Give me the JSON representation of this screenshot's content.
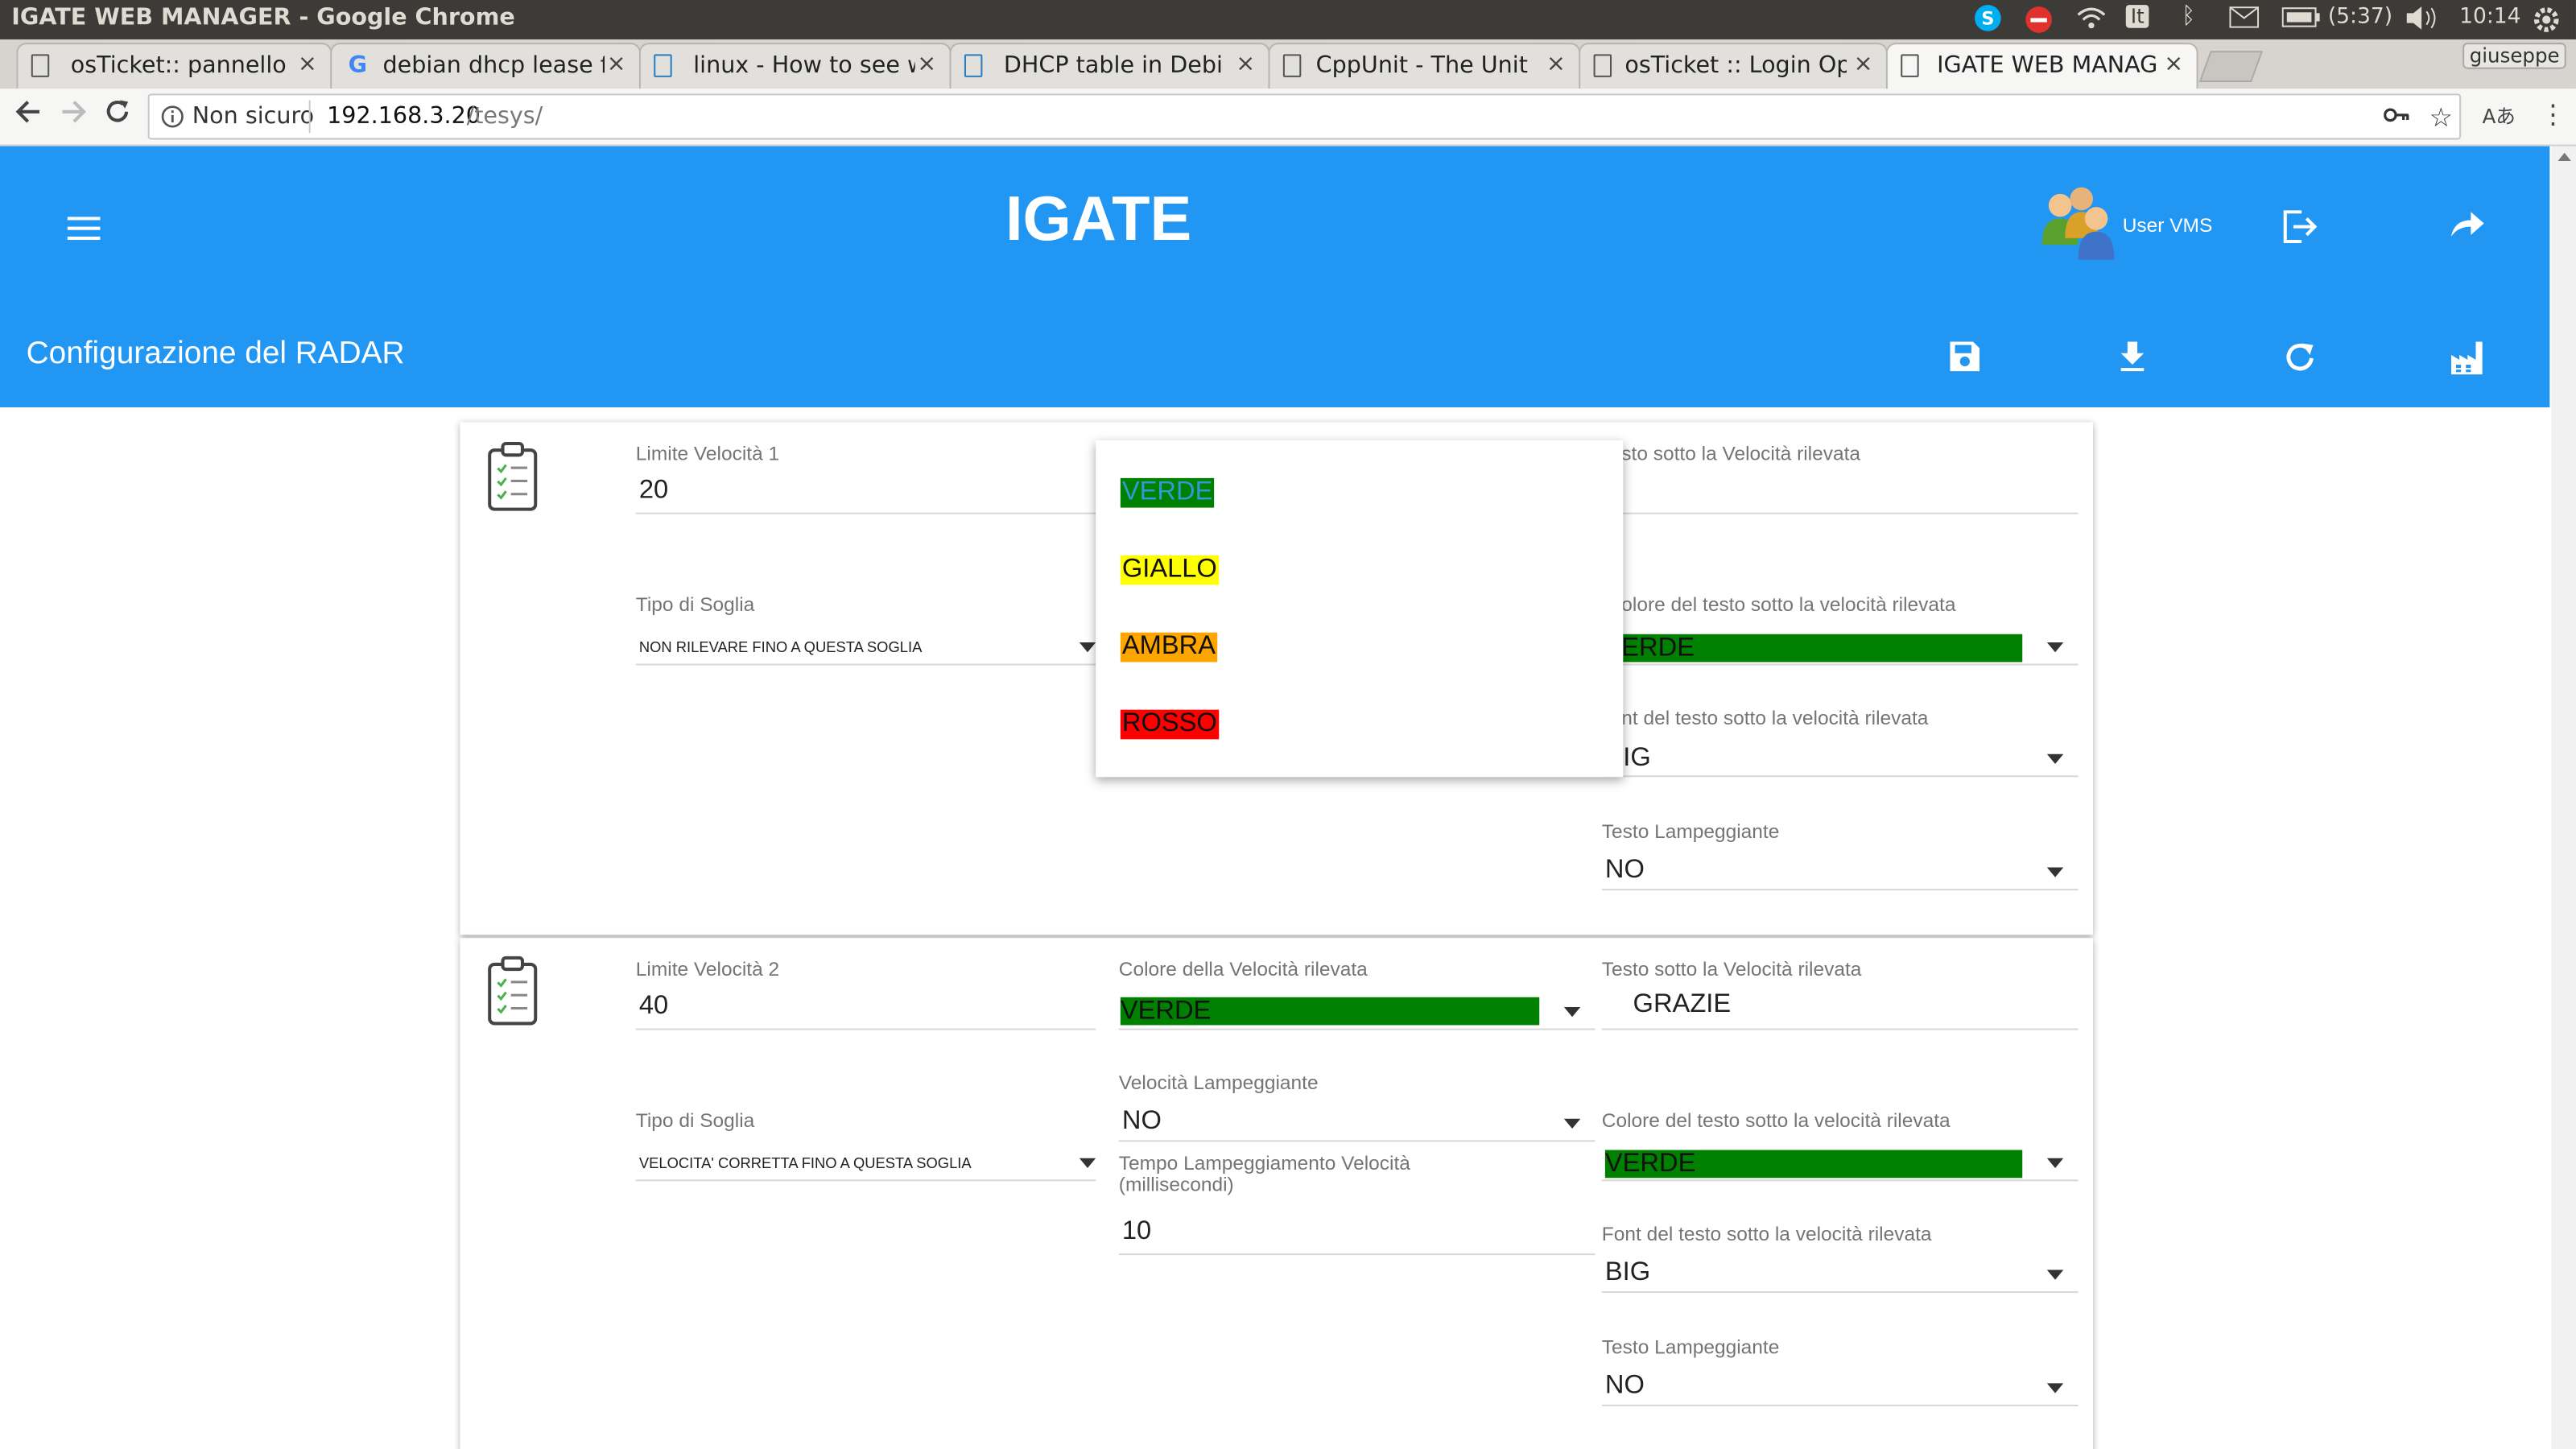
{
  "window": {
    "title": "IGATE WEB MANAGER - Google Chrome"
  },
  "tray": {
    "battery": "(5:37)",
    "time": "10:14",
    "keyboard": "It"
  },
  "tabs": [
    {
      "label": "osTicket:: pannello"
    },
    {
      "label": "debian dhcp lease f"
    },
    {
      "label": "linux - How to see w"
    },
    {
      "label": "DHCP table in Debi"
    },
    {
      "label": "CppUnit - The Unit"
    },
    {
      "label": "osTicket :: Login Op"
    },
    {
      "label": "IGATE WEB MANAG"
    }
  ],
  "profile": "giuseppe",
  "address": {
    "security": "Non sicuro",
    "host": "192.168.3.20",
    "path": "/tesys/"
  },
  "app": {
    "title": "IGATE",
    "user": "User VMS",
    "page_title": "Configurazione del RADAR"
  },
  "colors": {
    "appbar": "#2196f3",
    "verde": "#008000",
    "giallo": "#ffff00",
    "ambra": "#ffa500",
    "rosso": "#ff0000"
  },
  "card1": {
    "limit_label": "Limite Velocità 1",
    "limit_value": "20",
    "threshold_label": "Tipo di Soglia",
    "threshold_value": "NON RILEVARE FINO A QUESTA SOGLIA",
    "text_under_label": "sto sotto la Velocità rilevata",
    "text_color_label": "olore del testo sotto la velocità rilevata",
    "text_color_value": "ERDE",
    "font_label": "nt del testo sotto la velocità rilevata",
    "font_value": "IG",
    "blink_label": "Testo Lampeggiante",
    "blink_value": "NO"
  },
  "dropdown": {
    "items": [
      "VERDE",
      "GIALLO",
      "AMBRA",
      "ROSSO"
    ]
  },
  "card2": {
    "limit_label": "Limite Velocità 2",
    "limit_value": "40",
    "threshold_label": "Tipo di Soglia",
    "threshold_value": "VELOCITA' CORRETTA FINO A QUESTA SOGLIA",
    "speed_color_label": "Colore della Velocità rilevata",
    "speed_color_value": "VERDE",
    "speed_blink_label": "Velocità Lampeggiante",
    "speed_blink_value": "NO",
    "blink_time_label": "Tempo Lampeggiamento Velocità (millisecondi)",
    "blink_time_value": "10",
    "text_under_label": "Testo sotto la Velocità rilevata",
    "text_under_value": "GRAZIE",
    "text_color_label": "Colore del testo sotto la velocità rilevata",
    "text_color_value": "VERDE",
    "font_label": "Font del testo sotto la velocità rilevata",
    "font_value": "BIG",
    "blink_label": "Testo Lampeggiante",
    "blink_value": "NO"
  }
}
